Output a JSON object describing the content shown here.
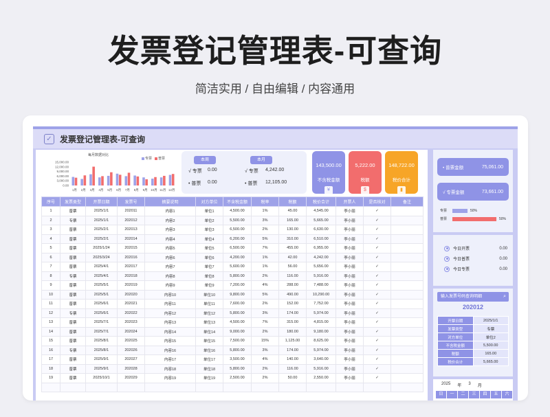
{
  "hero": {
    "title": "发票登记管理表-可查询",
    "subtitle": "简洁实用 / 自由编辑 / 内容通用"
  },
  "sheet": {
    "title": "发票登记管理表-可查询"
  },
  "chart_data": {
    "type": "bar",
    "title": "每月数据对比",
    "categories": [
      "1月",
      "2月",
      "3月",
      "4月",
      "5月",
      "6月",
      "7月",
      "8月",
      "9月",
      "10月",
      "11月",
      "12月"
    ],
    "series": [
      {
        "name": "专票",
        "values": [
          5500,
          4200,
          7200,
          5200,
          6200,
          7600,
          6000,
          6400,
          5200,
          4400,
          5200,
          6800
        ],
        "color": "#9ea2e8"
      },
      {
        "name": "普票",
        "values": [
          5000,
          6500,
          12100,
          6000,
          8500,
          6900,
          8200,
          5800,
          4000,
          5400,
          6200,
          7400
        ],
        "color": "#f26d6d"
      }
    ],
    "y_ticks": [
      "15,000.00",
      "12,000.00",
      "9,000.00",
      "6,000.00",
      "3,000.00",
      "0.00"
    ],
    "ylim": [
      0,
      15000
    ]
  },
  "summary": {
    "week_label": "本周",
    "month_label": "本月",
    "week": [
      {
        "label": "√ 专票",
        "value": "0.00"
      },
      {
        "label": "• 普票",
        "value": "0.00"
      }
    ],
    "month": [
      {
        "label": "√ 专票",
        "value": "4,242.00"
      },
      {
        "label": "• 普票",
        "value": "12,105.00"
      }
    ]
  },
  "tiles": [
    {
      "value": "143,500.00",
      "label": "不含税金额",
      "icon": "¥",
      "color": "#8f93e6"
    },
    {
      "value": "5,222.00",
      "label": "税额",
      "icon": "$",
      "color": "#f26d6d"
    },
    {
      "value": "148,722.00",
      "label": "税价合计",
      "icon": "▮",
      "color": "#f7a527"
    }
  ],
  "table": {
    "headers": [
      "序号",
      "发票类型",
      "开票日期",
      "发票号",
      "摘要说明",
      "对方单位",
      "不含税金额",
      "税率",
      "税额",
      "税价合计",
      "开票人",
      "是否核对",
      "备注"
    ],
    "rows": [
      [
        "1",
        "普票",
        "2025/1/1",
        "202011",
        "内容1",
        "单位1",
        "4,500.00",
        "1%",
        "45.00",
        "4,545.00",
        "李小丽",
        "✓",
        ""
      ],
      [
        "2",
        "专票",
        "2025/1/1",
        "202012",
        "内容2",
        "单位2",
        "5,500.00",
        "3%",
        "165.00",
        "5,665.00",
        "李小丽",
        "✓",
        ""
      ],
      [
        "3",
        "普票",
        "2025/2/1",
        "202013",
        "内容3",
        "单位3",
        "6,500.00",
        "2%",
        "130.00",
        "6,630.00",
        "李小丽",
        "✓",
        ""
      ],
      [
        "4",
        "普票",
        "2025/2/1",
        "202014",
        "内容4",
        "单位4",
        "6,200.00",
        "5%",
        "310.00",
        "6,510.00",
        "李小丽",
        "✓",
        ""
      ],
      [
        "5",
        "普票",
        "2025/1/24",
        "202015",
        "内容5",
        "单位5",
        "6,500.00",
        "7%",
        "455.00",
        "6,955.00",
        "李小丽",
        "✓",
        ""
      ],
      [
        "6",
        "普票",
        "2025/3/24",
        "202016",
        "内容6",
        "单位6",
        "4,200.00",
        "1%",
        "42.00",
        "4,242.00",
        "李小丽",
        "✓",
        ""
      ],
      [
        "7",
        "普票",
        "2025/4/1",
        "202017",
        "内容7",
        "单位7",
        "5,600.00",
        "1%",
        "56.00",
        "5,656.00",
        "李小丽",
        "✓",
        ""
      ],
      [
        "8",
        "专票",
        "2025/4/1",
        "202018",
        "内容8",
        "单位8",
        "5,800.00",
        "2%",
        "116.00",
        "5,916.00",
        "李小丽",
        "✓",
        ""
      ],
      [
        "9",
        "普票",
        "2025/5/1",
        "202019",
        "内容9",
        "单位9",
        "7,200.00",
        "4%",
        "288.00",
        "7,488.00",
        "李小丽",
        "✓",
        ""
      ],
      [
        "10",
        "普票",
        "2025/5/1",
        "202020",
        "内容10",
        "单位10",
        "9,800.00",
        "5%",
        "490.00",
        "10,290.00",
        "李小丽",
        "✓",
        ""
      ],
      [
        "11",
        "普票",
        "2025/6/1",
        "202021",
        "内容11",
        "单位11",
        "7,600.00",
        "2%",
        "152.00",
        "7,752.00",
        "李小丽",
        "✓",
        ""
      ],
      [
        "12",
        "专票",
        "2025/6/1",
        "202022",
        "内容12",
        "单位12",
        "5,800.00",
        "3%",
        "174.00",
        "5,974.00",
        "李小丽",
        "✓",
        ""
      ],
      [
        "13",
        "普票",
        "2025/7/1",
        "202023",
        "内容13",
        "单位13",
        "4,500.00",
        "7%",
        "315.00",
        "4,815.00",
        "李小丽",
        "✓",
        ""
      ],
      [
        "14",
        "普票",
        "2025/7/1",
        "202024",
        "内容14",
        "单位14",
        "9,000.00",
        "2%",
        "180.00",
        "9,180.00",
        "李小丽",
        "✓",
        ""
      ],
      [
        "15",
        "普票",
        "2025/8/1",
        "202025",
        "内容15",
        "单位15",
        "7,500.00",
        "15%",
        "1,125.00",
        "8,625.00",
        "李小丽",
        "✓",
        ""
      ],
      [
        "16",
        "专票",
        "2025/8/1",
        "202026",
        "内容16",
        "单位16",
        "5,800.00",
        "3%",
        "174.00",
        "5,974.00",
        "李小丽",
        "✓",
        ""
      ],
      [
        "17",
        "普票",
        "2025/9/1",
        "202027",
        "内容17",
        "单位17",
        "3,500.00",
        "4%",
        "140.00",
        "3,640.00",
        "李小丽",
        "✓",
        ""
      ],
      [
        "18",
        "普票",
        "2025/9/1",
        "202028",
        "内容18",
        "单位18",
        "5,800.00",
        "2%",
        "116.00",
        "5,916.00",
        "李小丽",
        "✓",
        ""
      ],
      [
        "19",
        "普票",
        "2025/10/1",
        "202029",
        "内容19",
        "单位19",
        "2,500.00",
        "2%",
        "50.00",
        "2,550.00",
        "李小丽",
        "✓",
        ""
      ],
      [
        "",
        "",
        "",
        "",
        "",
        "",
        "",
        "",
        "",
        "",
        "",
        "",
        ""
      ]
    ]
  },
  "right": {
    "pills": [
      {
        "label": "• 普票金额",
        "value": "75,061.00"
      },
      {
        "label": "√ 专票金额",
        "value": "73,661.00"
      }
    ],
    "bars": [
      {
        "label": "专票",
        "pct": "50%",
        "fraction": 0.5,
        "color": "#9ea2e8"
      },
      {
        "label": "普票",
        "pct": "50%",
        "fraction": 0.5,
        "color": "#f26d6d"
      }
    ],
    "today": [
      {
        "label": "今日开票",
        "value": "0.00"
      },
      {
        "label": "今日普票",
        "value": "0.00"
      },
      {
        "label": "今日专票",
        "value": "0.00"
      }
    ],
    "query": {
      "input_label": "输入发票号码查询明细",
      "input_value": "202012",
      "rows": [
        {
          "k": "开票日期",
          "v": "2025/1/1"
        },
        {
          "k": "发票类型",
          "v": "专票"
        },
        {
          "k": "对方单位",
          "v": "单位2"
        },
        {
          "k": "不含税金额",
          "v": "5,500.00"
        },
        {
          "k": "税额",
          "v": "165.00"
        },
        {
          "k": "税价合计",
          "v": "5,665.00"
        }
      ]
    },
    "calendar": {
      "year": "2025",
      "year_unit": "年",
      "month": "3",
      "month_unit": "月",
      "days": [
        "日",
        "一",
        "二",
        "三",
        "四",
        "五",
        "六"
      ]
    }
  }
}
